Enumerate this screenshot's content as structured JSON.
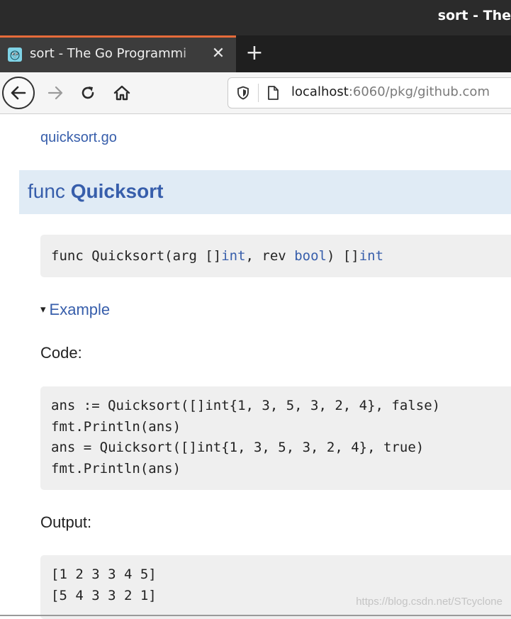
{
  "window": {
    "title": "sort - The"
  },
  "tabs": [
    {
      "favicon": "gopher-icon",
      "label": "sort - The Go Programmi",
      "close_symbol": "✕"
    }
  ],
  "new_tab_symbol": "+",
  "navigation": {
    "back": "arrow-left-icon",
    "forward": "arrow-right-icon",
    "reload": "reload-icon",
    "home": "home-icon"
  },
  "address_bar": {
    "host": "localhost",
    "rest": ":6060/pkg/github.com"
  },
  "page": {
    "source_link": "quicksort.go",
    "func_heading": {
      "keyword": "func",
      "name": "Quicksort"
    },
    "signature": {
      "prefix": "func Quicksort(arg []",
      "type1": "int",
      "middle": ", rev ",
      "type2": "bool",
      "after": ") []",
      "type3": "int"
    },
    "example_arrow": "▾",
    "example_label": "Example",
    "code_label": "Code:",
    "code_lines": [
      "ans := Quicksort([]int{1, 3, 5, 3, 2, 4}, false)",
      "fmt.Println(ans)",
      "ans = Quicksort([]int{1, 3, 5, 3, 2, 4}, true)",
      "fmt.Println(ans)"
    ],
    "output_label": "Output:",
    "output_lines": [
      "[1 2 3 3 4 5]",
      "[5 4 3 3 2 1]"
    ],
    "watermark": "https://blog.csdn.net/STcyclone"
  },
  "colors": {
    "link": "#375eab",
    "header_bg": "#e0ebf5",
    "code_bg": "#efefef",
    "tab_accent": "#e66b3a"
  }
}
